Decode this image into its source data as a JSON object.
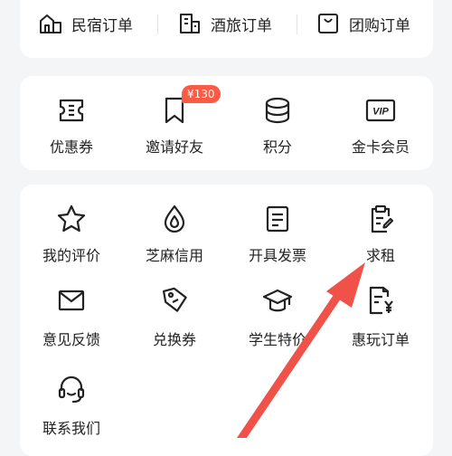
{
  "orders": [
    {
      "label": "民宿订单",
      "icon": "homestay-icon"
    },
    {
      "label": "酒旅订单",
      "icon": "hotel-building-icon"
    },
    {
      "label": "团购订单",
      "icon": "shopping-bag-icon"
    }
  ],
  "assets": [
    {
      "label": "优惠券",
      "icon": "ticket-icon"
    },
    {
      "label": "邀请好友",
      "icon": "bookmark-icon",
      "badge": "¥130"
    },
    {
      "label": "积分",
      "icon": "coin-stack-icon"
    },
    {
      "label": "金卡会员",
      "icon": "vip-card-icon",
      "icon_text": "VIP"
    }
  ],
  "services": [
    {
      "label": "我的评价",
      "icon": "star-icon"
    },
    {
      "label": "芝麻信用",
      "icon": "sesame-drop-icon"
    },
    {
      "label": "开具发票",
      "icon": "invoice-icon"
    },
    {
      "label": "求租",
      "icon": "clipboard-pen-icon"
    },
    {
      "label": "意见反馈",
      "icon": "envelope-icon"
    },
    {
      "label": "兑换券",
      "icon": "tag-icon"
    },
    {
      "label": "学生特价",
      "icon": "graduation-cap-icon"
    },
    {
      "label": "惠玩订单",
      "icon": "yen-document-icon"
    },
    {
      "label": "联系我们",
      "icon": "headset-icon"
    }
  ],
  "colors": {
    "accent": "#f0524a",
    "badge": "#fb5b44",
    "icon_stroke": "#222222",
    "background": "#f3f5f7"
  }
}
